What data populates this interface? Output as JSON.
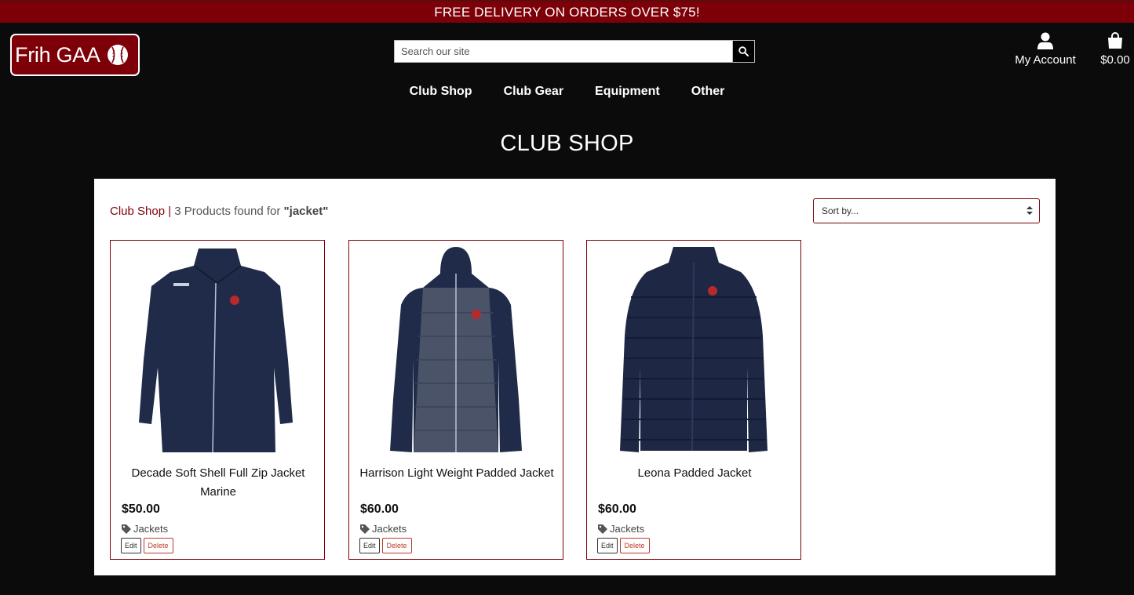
{
  "banner": {
    "text": "FREE DELIVERY ON ORDERS OVER $75!"
  },
  "logo": {
    "text": "Frih GAA",
    "icon": "sliotar-ball-icon"
  },
  "search": {
    "placeholder": "Search our site",
    "icon": "search-icon"
  },
  "account": {
    "label": "My Account",
    "icon": "user-icon"
  },
  "bag": {
    "label": "$0.00",
    "icon": "shopping-bag-icon"
  },
  "nav": {
    "items": [
      {
        "label": "Club Shop"
      },
      {
        "label": "Club Gear"
      },
      {
        "label": "Equipment"
      },
      {
        "label": "Other"
      }
    ]
  },
  "page": {
    "title": "CLUB SHOP"
  },
  "results": {
    "crumb": "Club Shop",
    "separator": " | ",
    "text": "3 Products found for ",
    "query": "\"jacket\""
  },
  "sort": {
    "selected": "Sort by..."
  },
  "products": [
    {
      "name": "Decade Soft Shell Full Zip Jacket Marine",
      "price": "$50.00",
      "category": "Jackets",
      "edit": "Edit",
      "delete": "Delete"
    },
    {
      "name": "Harrison Light Weight Padded Jacket",
      "price": "$60.00",
      "category": "Jackets",
      "edit": "Edit",
      "delete": "Delete"
    },
    {
      "name": "Leona Padded Jacket",
      "price": "$60.00",
      "category": "Jackets",
      "edit": "Edit",
      "delete": "Delete"
    }
  ],
  "colors": {
    "brand": "#7d0008",
    "background": "#0c0b0b",
    "jacket_navy": "#1e2a47"
  }
}
